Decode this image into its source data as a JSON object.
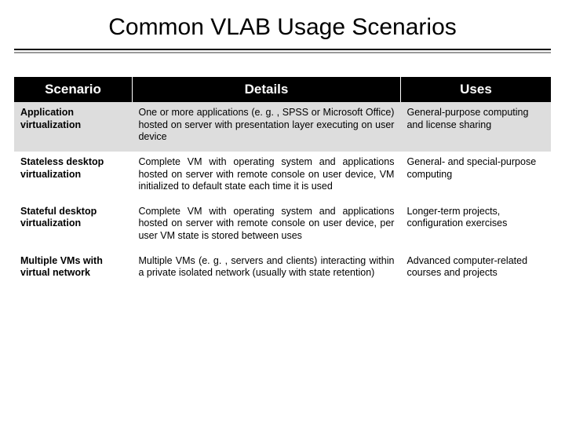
{
  "title": "Common VLAB Usage Scenarios",
  "headers": {
    "scenario": "Scenario",
    "details": "Details",
    "uses": "Uses"
  },
  "rows": [
    {
      "scenario": "Application virtualization",
      "details": "One or more applications (e. g. , SPSS or Microsoft Office) hosted on server with presentation layer executing on user device",
      "uses": "General-purpose computing and license sharing"
    },
    {
      "scenario": "Stateless desktop virtualization",
      "details": "Complete VM with operating system and applications hosted on server with remote console on user device, VM initialized to default state each time it is used",
      "uses": "General- and special-purpose computing"
    },
    {
      "scenario": "Stateful desktop virtualization",
      "details": "Complete VM with operating system and applications hosted on server with remote console on user device, per user VM state is stored between uses",
      "uses": "Longer-term projects, configuration exercises"
    },
    {
      "scenario": "Multiple VMs with virtual network",
      "details": "Multiple VMs (e. g. , servers and clients) interacting within a private isolated network (usually with state retention)",
      "uses": "Advanced computer-related courses and projects"
    }
  ]
}
